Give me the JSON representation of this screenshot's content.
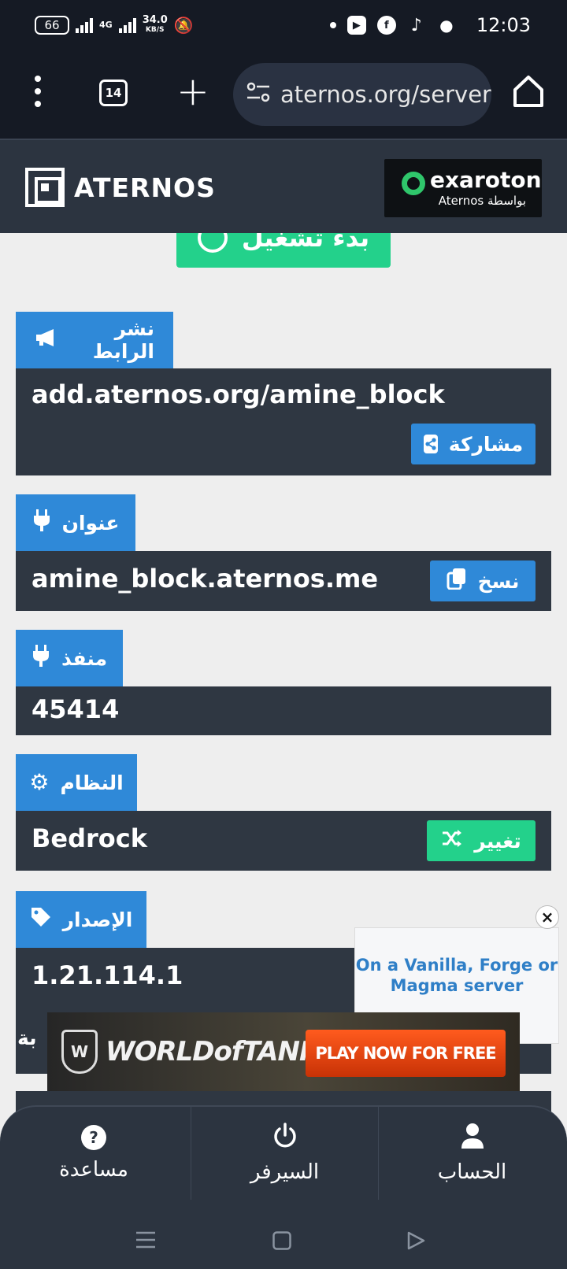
{
  "status_bar": {
    "battery": "66",
    "network": "4G",
    "speed": "34.0",
    "speed_unit": "KB/S",
    "time": "12:03"
  },
  "browser": {
    "tab_count": "14",
    "url": "aternos.org/server/"
  },
  "header": {
    "logo_text": "ATERNOS",
    "partner_name": "exaroton",
    "partner_sub": "Aternos بواسطة"
  },
  "main": {
    "start_button": "بدء تشغيل",
    "sections": [
      {
        "tag": "نشر الرابط",
        "value": "add.aternos.org/amine_block",
        "button": "مشاركة"
      },
      {
        "tag": "عنوان",
        "value": "amine_block.aternos.me",
        "button": "نسخ"
      },
      {
        "tag": "منفذ",
        "value": "45414"
      },
      {
        "tag": "النظام",
        "value": "Bedrock",
        "button": "تغيير"
      },
      {
        "tag": "الإصدار",
        "value": "1.21.114.1"
      }
    ],
    "partial_text": "بة"
  },
  "ads": {
    "side_text": "On a Vanilla, Forge or Magma server",
    "close": "×",
    "banner_title": "WORLDofTANKS",
    "banner_cta": "PLAY NOW FOR FREE"
  },
  "bottom_nav": {
    "items": [
      {
        "label": "مساعدة"
      },
      {
        "label": "السيرفر"
      },
      {
        "label": "الحساب"
      }
    ]
  },
  "colors": {
    "primary_blue": "#2f89d8",
    "success_green": "#23d18b",
    "panel_dark": "#2f3742"
  }
}
